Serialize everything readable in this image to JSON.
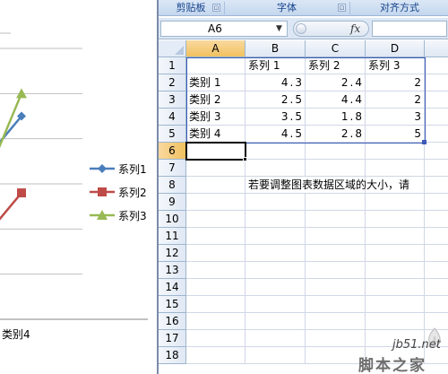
{
  "ribbon": {
    "groups": [
      {
        "label": "剪贴板"
      },
      {
        "label": "字体"
      },
      {
        "label": "对齐方式"
      }
    ],
    "launcher_glyph": "⊡"
  },
  "formula_bar": {
    "name_box": "A6",
    "fx_label": "fx",
    "formula": ""
  },
  "sheet": {
    "columns": [
      "A",
      "B",
      "C",
      "D"
    ],
    "rows": [
      "1",
      "2",
      "3",
      "4",
      "5",
      "6",
      "7",
      "8",
      "9",
      "10",
      "11",
      "12",
      "13",
      "14",
      "15",
      "16",
      "17",
      "18"
    ],
    "active_cell": "A6",
    "cells": {
      "r1": [
        "",
        "系列 1",
        "系列 2",
        "系列 3"
      ],
      "r2": [
        "类别 1",
        "4.3",
        "2.4",
        "2"
      ],
      "r3": [
        "类别 2",
        "2.5",
        "4.4",
        "2"
      ],
      "r4": [
        "类别 3",
        "3.5",
        "1.8",
        "3"
      ],
      "r5": [
        "类别 4",
        "4.5",
        "2.8",
        "5"
      ]
    },
    "note": "若要调整图表数据区域的大小，请"
  },
  "chart": {
    "legend": [
      {
        "label": "系列1",
        "color": "#4a7ebb",
        "marker": "diamond"
      },
      {
        "label": "系列2",
        "color": "#be4b48",
        "marker": "square"
      },
      {
        "label": "系列3",
        "color": "#98b954",
        "marker": "triangle"
      }
    ],
    "visible_category_label": "类别 4"
  },
  "chart_data": {
    "type": "line",
    "categories": [
      "类别 1",
      "类别 2",
      "类别 3",
      "类别 4"
    ],
    "series": [
      {
        "name": "系列1",
        "values": [
          4.3,
          2.5,
          3.5,
          4.5
        ],
        "color": "#4a7ebb"
      },
      {
        "name": "系列2",
        "values": [
          2.4,
          4.4,
          1.8,
          2.8
        ],
        "color": "#be4b48"
      },
      {
        "name": "系列3",
        "values": [
          2,
          2,
          3,
          5
        ],
        "color": "#98b954"
      }
    ],
    "ylim": [
      0,
      6
    ],
    "grid": true,
    "legend_position": "right"
  },
  "watermark": {
    "url": "jb51.net",
    "name": "脚本之家"
  }
}
